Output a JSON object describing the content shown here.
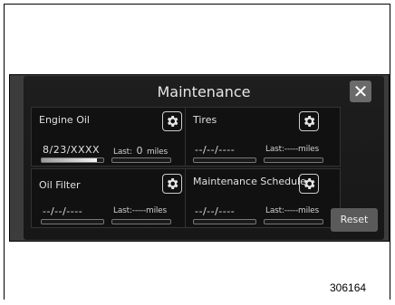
{
  "window": {
    "title": "Maintenance",
    "close_symbol": "✕"
  },
  "cards": {
    "engine_oil": {
      "title": "Engine Oil",
      "date": "8/23/XXXX",
      "last_label": "Last:",
      "last_value": "0",
      "unit": "miles",
      "progress": 0.9
    },
    "tires": {
      "title": "Tires",
      "date": "--/--/----",
      "last_text": "Last:-----miles",
      "progress": 0
    },
    "oil_filter": {
      "title": "Oil Filter",
      "date": "--/--/----",
      "last_text": "Last:-----miles",
      "progress": 0
    },
    "maintenance_schedule": {
      "title": "Maintenance Schedule",
      "date": "--/--/----",
      "last_text": "Last:-----miles",
      "progress": 0
    }
  },
  "reset_label": "Reset",
  "figure_number": "306164",
  "icons": {
    "settings": "gear-icon",
    "close": "close-icon"
  }
}
